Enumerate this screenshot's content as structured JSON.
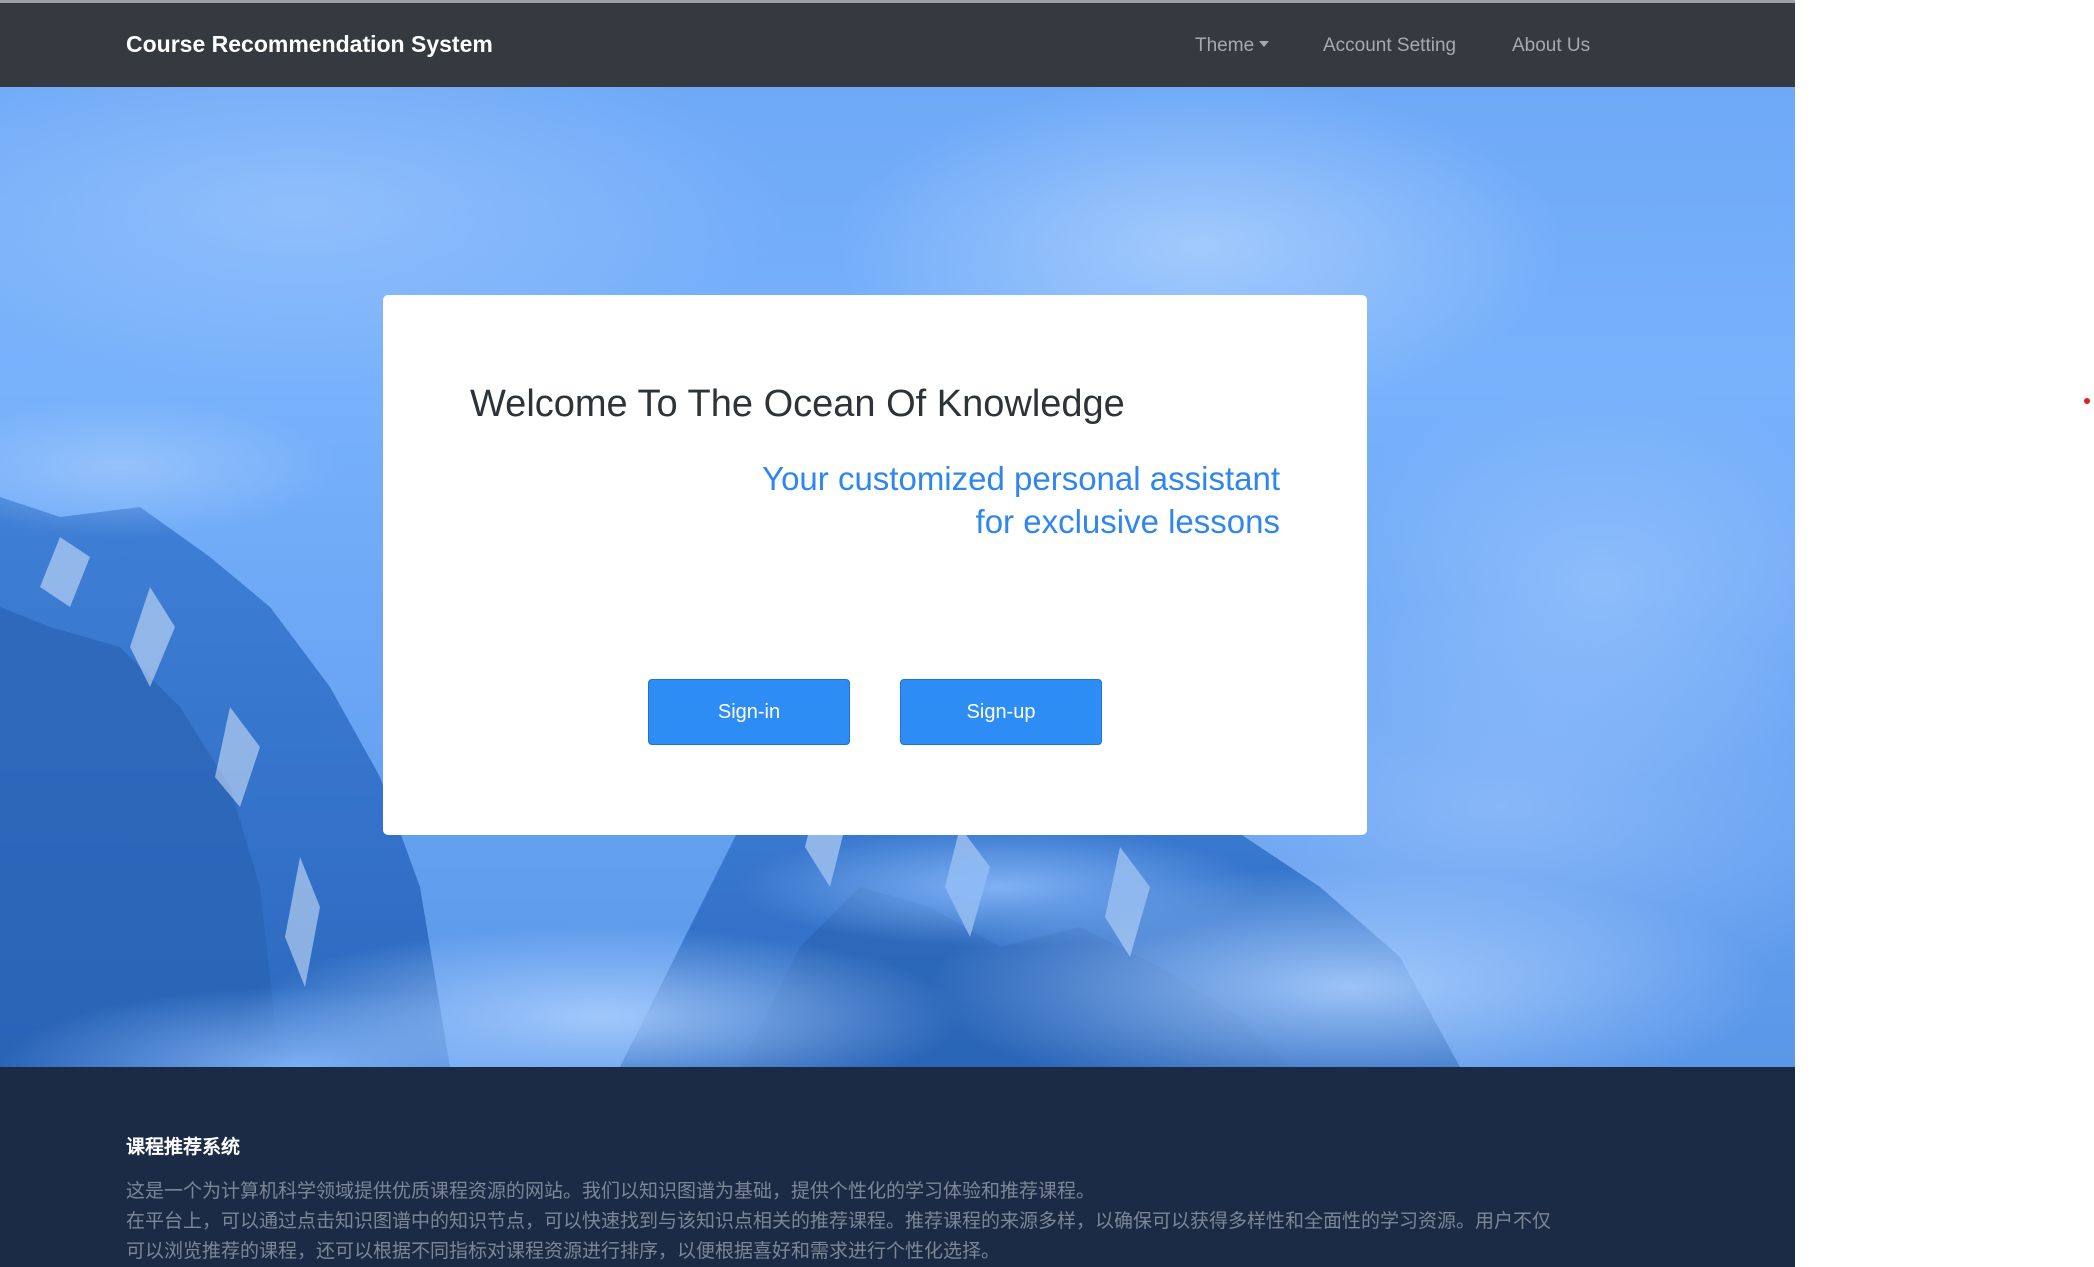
{
  "navbar": {
    "brand": "Course Recommendation System",
    "items": [
      {
        "label": "Theme"
      },
      {
        "label": "Account Setting"
      },
      {
        "label": "About Us"
      }
    ]
  },
  "hero": {
    "title": "Welcome To The Ocean Of Knowledge",
    "subtitle": "Your customized personal assistant for exclusive lessons",
    "signin_label": "Sign-in",
    "signup_label": "Sign-up"
  },
  "footer": {
    "title": "课程推荐系统",
    "lines": [
      "这是一个为计算机科学领域提供优质课程资源的网站。我们以知识图谱为基础，提供个性化的学习体验和推荐课程。",
      "在平台上，可以通过点击知识图谱中的知识节点，可以快速找到与该知识点相关的推荐课程。推荐课程的来源多样，以确保可以获得多样性和全面性的学习资源。用户不仅可以浏览推荐的课程，还可以根据不同指标对课程资源进行排序，以便根据喜好和需求进行个性化选择。"
    ]
  },
  "colors": {
    "navbar_bg": "#343a40",
    "hero_blue": "#72aefa",
    "accent": "#2e8cf5",
    "subtitle": "#2f86ee",
    "footer_bg": "#1b2b45"
  },
  "icons": {
    "theme_dropdown": "caret-down-icon"
  }
}
